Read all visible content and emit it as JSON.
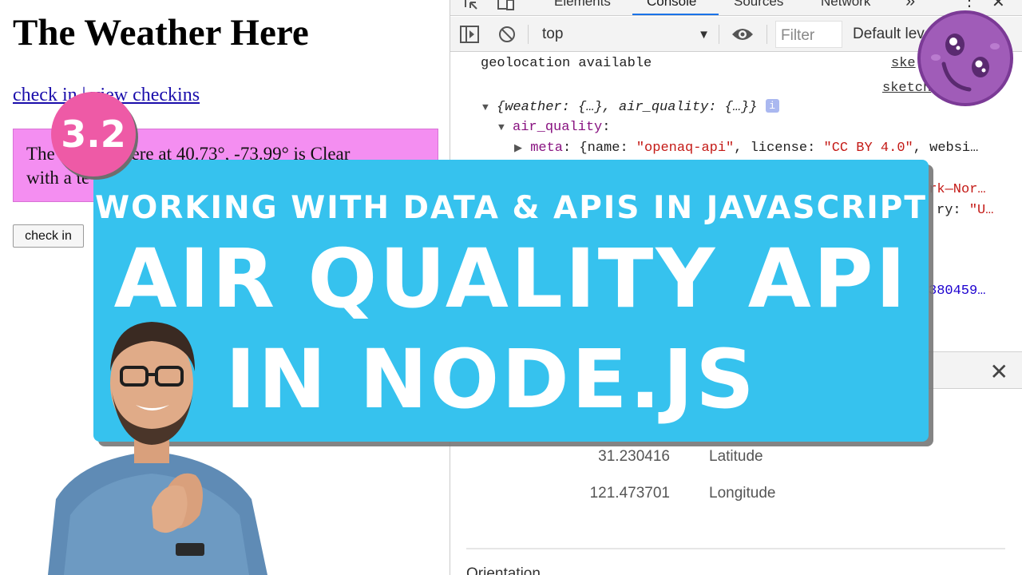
{
  "page": {
    "title": "The Weather Here",
    "link_checkin": "check in",
    "link_separator": "|",
    "link_view": "view checkins",
    "weather_line1": "The weather here at 40.73°, -73.99° is Clear",
    "weather_line2": "with a te",
    "checkin_button": "check in"
  },
  "devtools": {
    "tabs": [
      "Elements",
      "Console",
      "Sources",
      "Network"
    ],
    "more_tabs": "»",
    "context": "top",
    "filter_placeholder": "Filter",
    "levels": "Default levels",
    "console": {
      "line1": "geolocation available",
      "link1": "ske",
      "link2": "sketch",
      "obj_summary": "{weather: {…}, air_quality: {…}}",
      "air_quality_key": "air_quality",
      "meta_key": "meta",
      "meta_name_key": "name",
      "meta_name_val": "\"openaq-api\"",
      "meta_license_key": "license",
      "meta_license_val": "\"CC BY 4.0\"",
      "meta_rest": "websi…",
      "frag1": "ork—Nor…",
      "frag2_key": "ry:",
      "frag2_val": "\"U…",
      "frag3": "380459…"
    },
    "sensors": {
      "latitude_value": "31.230416",
      "latitude_label": "Latitude",
      "longitude_value": "121.473701",
      "longitude_label": "Longitude",
      "orientation_label": "Orientation"
    }
  },
  "thumbnail": {
    "subtitle": "Working with Data & APIs in JavaScript",
    "title_line1": "Air Quality API",
    "title_line2": "in Node.js",
    "episode": "3.2",
    "banner_color": "#36c2ee",
    "badge_color": "#ee5aa6",
    "mascot_color": "#9b59b6"
  }
}
